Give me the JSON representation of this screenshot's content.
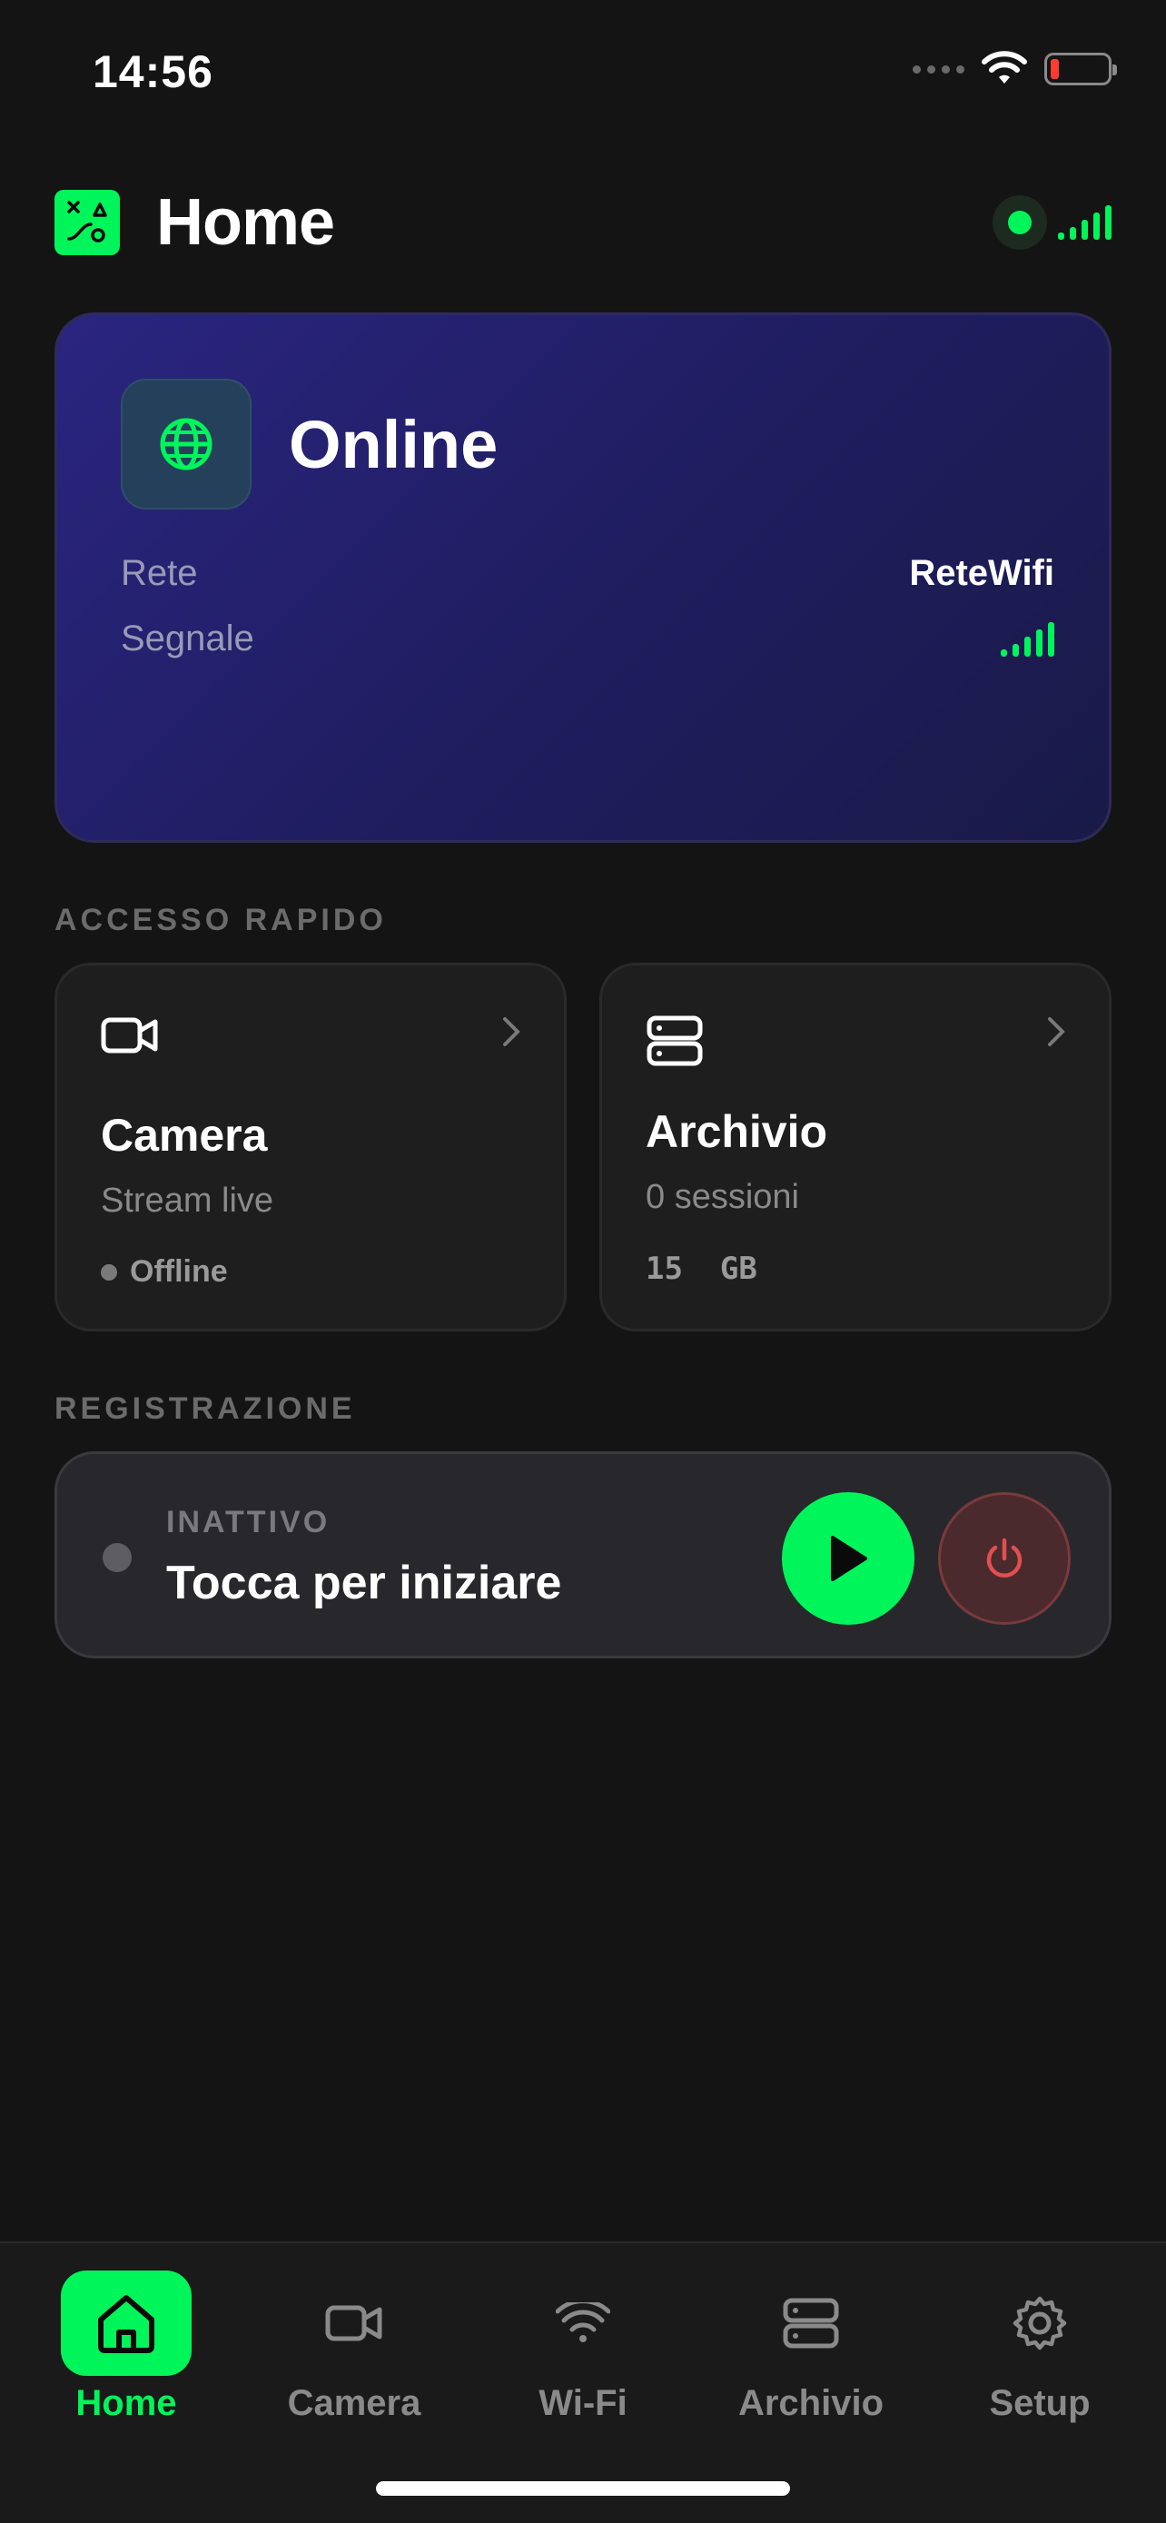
{
  "status_bar": {
    "time": "14:56"
  },
  "header": {
    "title": "Home",
    "connection_color": "#00f55a"
  },
  "network": {
    "status": "Online",
    "rows": [
      {
        "label": "Rete",
        "value": "ReteWifi"
      },
      {
        "label": "Segnale",
        "value": ""
      }
    ],
    "signal_level": 5
  },
  "quick_access": {
    "section_label": "ACCESSO RAPIDO",
    "camera": {
      "title": "Camera",
      "subtitle": "Stream live",
      "status": "Offline",
      "icon": "video-camera-icon"
    },
    "archive": {
      "title": "Archivio",
      "subtitle": "0 sessioni",
      "size": "15  GB",
      "icon": "storage-icon"
    }
  },
  "recording": {
    "section_label": "REGISTRAZIONE",
    "state": "INATTIVO",
    "hint": "Tocca per iniziare"
  },
  "bottom_nav": {
    "items": [
      {
        "label": "Home",
        "icon": "home-icon",
        "active": true
      },
      {
        "label": "Camera",
        "icon": "video-camera-icon",
        "active": false
      },
      {
        "label": "Wi-Fi",
        "icon": "wifi-icon",
        "active": false
      },
      {
        "label": "Archivio",
        "icon": "storage-icon",
        "active": false
      },
      {
        "label": "Setup",
        "icon": "gear-icon",
        "active": false
      }
    ]
  },
  "colors": {
    "accent": "#00f55a",
    "danger": "#e05050",
    "card_gradient_start": "#2a2580"
  }
}
